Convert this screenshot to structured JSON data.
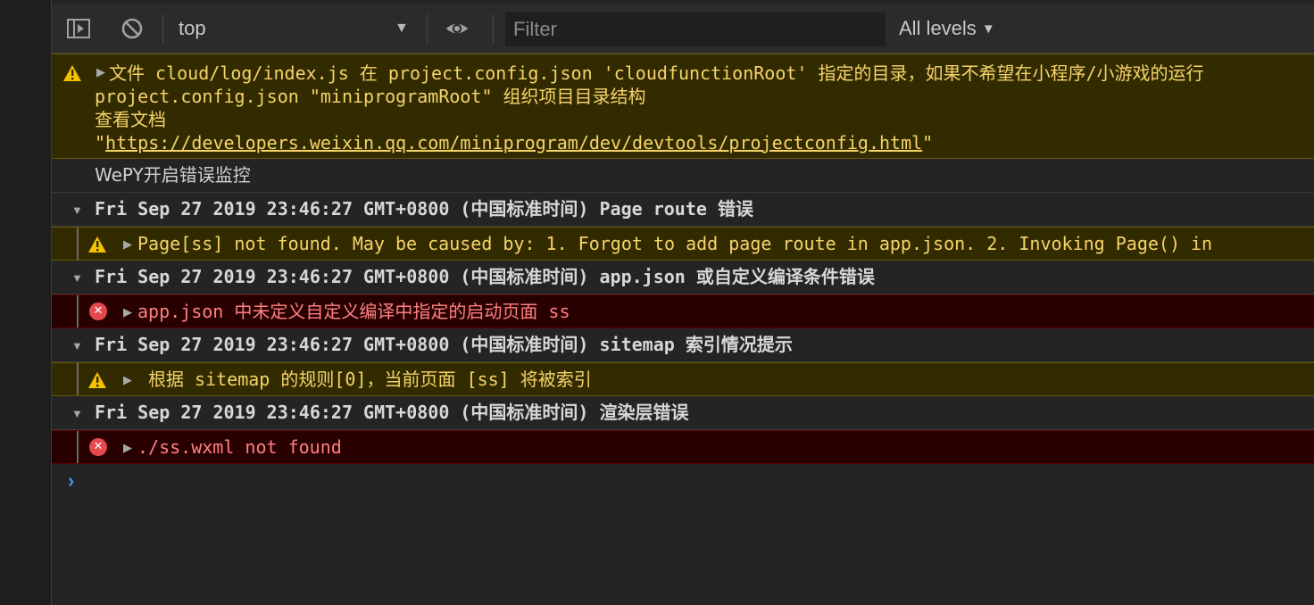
{
  "toolbar": {
    "context": "top",
    "filter_placeholder": "Filter",
    "levels_label": "All levels"
  },
  "messages": {
    "warn1": {
      "line1": "文件 cloud/log/index.js 在 project.config.json 'cloudfunctionRoot' 指定的目录，如果不希望在小程序/小游戏的运行",
      "line2": "project.config.json \"miniprogramRoot\" 组织项目目录结构",
      "line3": "查看文档",
      "quote_open": "\"",
      "link": "https://developers.weixin.qq.com/miniprogram/dev/devtools/projectconfig.html",
      "quote_close": "\""
    },
    "log1": "WePY开启错误监控",
    "group1": {
      "title": "Fri Sep 27 2019 23:46:27 GMT+0800 (中国标准时间) Page route 错误",
      "child": "Page[ss] not found. May be caused by: 1. Forgot to add page route in app.json. 2. Invoking Page() in"
    },
    "group2": {
      "title": "Fri Sep 27 2019 23:46:27 GMT+0800 (中国标准时间) app.json 或自定义编译条件错误",
      "child": "app.json 中未定义自定义编译中指定的启动页面 ss"
    },
    "group3": {
      "title": "Fri Sep 27 2019 23:46:27 GMT+0800 (中国标准时间) sitemap 索引情况提示",
      "child": "根据 sitemap 的规则[0]，当前页面 [ss] 将被索引"
    },
    "group4": {
      "title": "Fri Sep 27 2019 23:46:27 GMT+0800 (中国标准时间) 渲染层错误",
      "child": "./ss.wxml not found"
    }
  },
  "icons": {
    "sidebar": "sidebar-toggle-icon",
    "clear": "clear-console-icon",
    "eye": "live-expression-eye-icon",
    "warning": "warning-icon",
    "error": "error-icon"
  },
  "colors": {
    "warning_bg": "#332b00",
    "warning_text": "#f5d36a",
    "error_bg": "#290000",
    "error_text": "#ff8080",
    "prompt": "#4d8df0"
  }
}
